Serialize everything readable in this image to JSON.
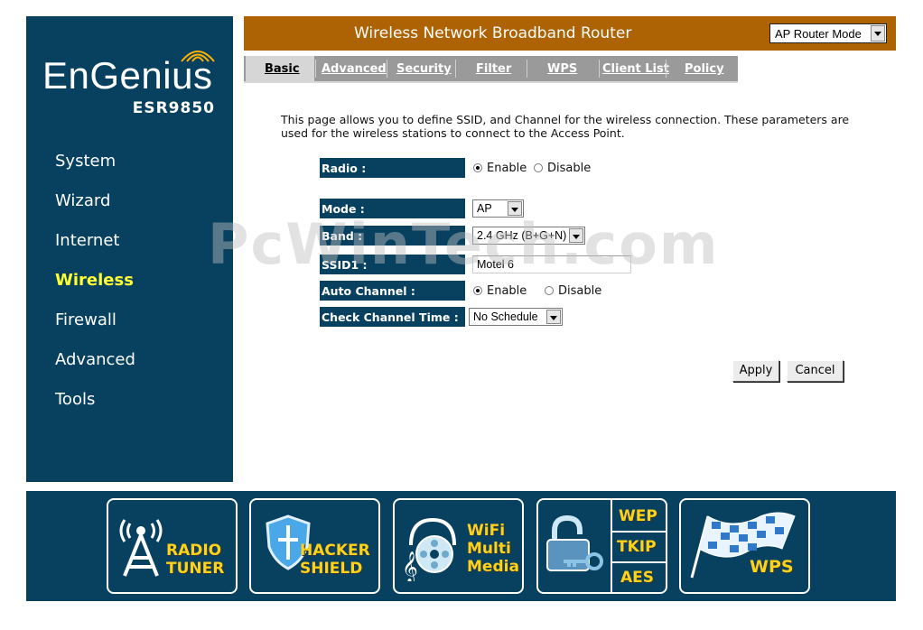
{
  "brand": {
    "logo": "EnGenius",
    "model": "ESR9850"
  },
  "sidebar": {
    "items": [
      {
        "label": "System"
      },
      {
        "label": "Wizard"
      },
      {
        "label": "Internet"
      },
      {
        "label": "Wireless",
        "active": true
      },
      {
        "label": "Firewall"
      },
      {
        "label": "Advanced"
      },
      {
        "label": "Tools"
      }
    ]
  },
  "header": {
    "title": "Wireless Network Broadband Router",
    "mode": "AP Router Mode"
  },
  "tabs": [
    {
      "label": "Basic",
      "active": true
    },
    {
      "label": "Advanced"
    },
    {
      "label": "Security"
    },
    {
      "label": "Filter"
    },
    {
      "label": "WPS"
    },
    {
      "label": "Client List"
    },
    {
      "label": "Policy"
    }
  ],
  "description": "This page allows you to define SSID, and Channel for the wireless connection. These parameters are used for the wireless stations to connect to the Access Point.",
  "form": {
    "radio": {
      "label": "Radio :",
      "enable": "Enable",
      "disable": "Disable",
      "selected": "Enable"
    },
    "mode": {
      "label": "Mode :",
      "value": "AP"
    },
    "band": {
      "label": "Band :",
      "value": "2.4 GHz (B+G+N)"
    },
    "ssid": {
      "label": "SSID1 :",
      "value": "Motel 6"
    },
    "auto_channel": {
      "label": "Auto Channel :",
      "enable": "Enable",
      "disable": "Disable",
      "selected": "Enable"
    },
    "check_time": {
      "label": "Check Channel Time :",
      "value": "No Schedule"
    }
  },
  "buttons": {
    "apply": "Apply",
    "cancel": "Cancel"
  },
  "watermark": "PcWinTech.com",
  "features": [
    {
      "icon": "radio-tower-icon",
      "lines": [
        "RADIO",
        "TUNER"
      ]
    },
    {
      "icon": "shield-icon",
      "lines": [
        "HACKER",
        "SHIELD"
      ]
    },
    {
      "icon": "multimedia-icon",
      "lines": [
        "WiFi",
        "Multi",
        "Media"
      ]
    },
    {
      "icon": "lock-icon",
      "lines": [
        "WEP",
        "TKIP",
        "AES"
      ]
    },
    {
      "icon": "flag-icon",
      "lines": [
        "WPS"
      ]
    }
  ],
  "colors": {
    "navy": "#07415f",
    "header": "#ad6204",
    "active_nav": "#ffff33",
    "banner_text": "#ffd21a"
  }
}
